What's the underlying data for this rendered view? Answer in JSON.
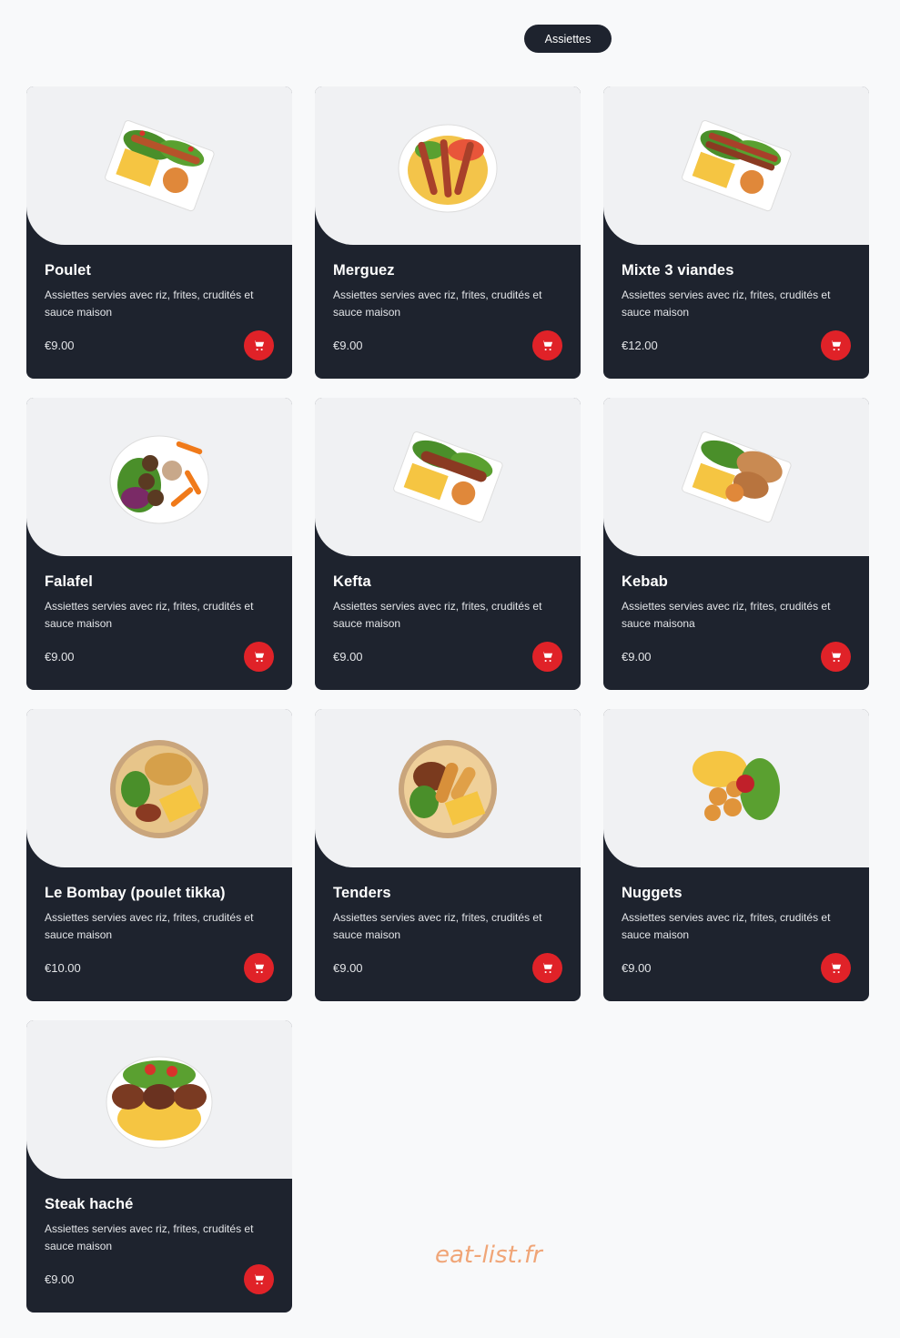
{
  "category": {
    "label": "Assiettes"
  },
  "colors": {
    "card_bg": "#1e232e",
    "card_image_bg": "#f0f1f3",
    "cart_button": "#e02228",
    "watermark": "#f0a577"
  },
  "items": [
    {
      "name": "Poulet",
      "description": "Assiettes servies avec riz, frites, crudités et sauce maison",
      "price": "€9.00",
      "image": "rect-plate"
    },
    {
      "name": "Merguez",
      "description": "Assiettes servies avec riz, frites, crudités et sauce maison",
      "price": "€9.00",
      "image": "round-plate"
    },
    {
      "name": "Mixte 3 viandes",
      "description": "Assiettes servies avec riz, frites, crudités et sauce maison",
      "price": "€12.00",
      "image": "rect-plate"
    },
    {
      "name": "Falafel",
      "description": "Assiettes servies avec riz, frites, crudités et sauce maison",
      "price": "€9.00",
      "image": "round-plate"
    },
    {
      "name": "Kefta",
      "description": "Assiettes servies avec riz, frites, crudités et sauce maison",
      "price": "€9.00",
      "image": "rect-plate"
    },
    {
      "name": "Kebab",
      "description": "Assiettes servies avec riz, frites, crudités et sauce maisona",
      "price": "€9.00",
      "image": "rect-plate"
    },
    {
      "name": "Le Bombay (poulet tikka)",
      "description": "Assiettes servies avec riz, frites, crudités et sauce maison",
      "price": "€10.00",
      "image": "bowl"
    },
    {
      "name": "Tenders",
      "description": "Assiettes servies avec riz, frites, crudités et sauce maison",
      "price": "€9.00",
      "image": "bowl"
    },
    {
      "name": "Nuggets",
      "description": "Assiettes servies avec riz, frites, crudités et sauce maison",
      "price": "€9.00",
      "image": "loose"
    },
    {
      "name": "Steak haché",
      "description": "Assiettes servies avec riz, frites, crudités et sauce maison",
      "price": "€9.00",
      "image": "round-plate"
    }
  ],
  "cart_icon": "cart-icon",
  "watermark": "eat-list.fr"
}
